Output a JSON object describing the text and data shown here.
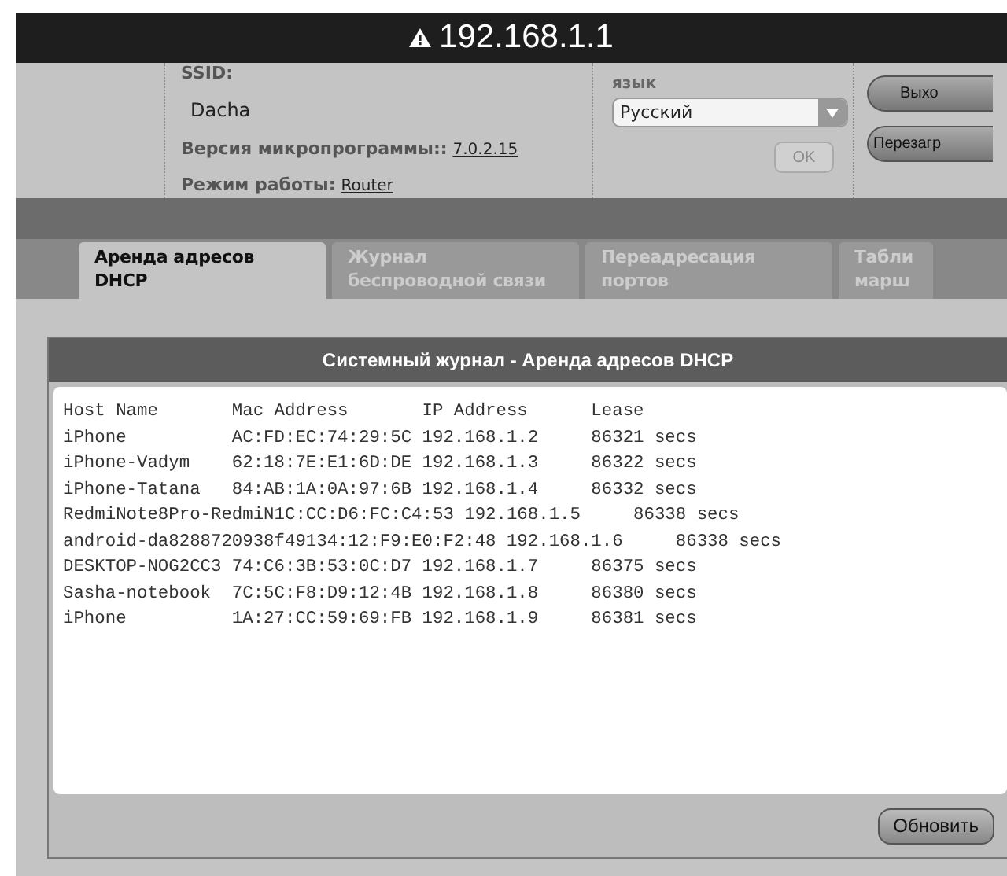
{
  "window": {
    "title": "192.168.1.1"
  },
  "header": {
    "ssid_label": "SSID:",
    "ssid": "Dacha",
    "firmware_label": "Версия микропрограммы::",
    "firmware": "7.0.2.15",
    "mode_label": "Режим работы:",
    "mode": "Router",
    "language_label": "язык",
    "language": "Русский",
    "ok_button": {
      "label": "OK",
      "disabled": true
    },
    "buttons": [
      "Выхо",
      "Перезагр"
    ]
  },
  "tabs": [
    {
      "label": "Аренда адресов DHCP",
      "selected": true
    },
    {
      "label": "Журнал беспроводной связи",
      "selected": false
    },
    {
      "label": "Переадресация портов",
      "selected": false
    },
    {
      "label": "Табли марш",
      "selected": false
    }
  ],
  "panel": {
    "title": "Системный журнал - Аренда адресов DHCP",
    "log_lines": [
      "Host Name       Mac Address       IP Address      Lease",
      "iPhone          AC:FD:EC:74:29:5C 192.168.1.2     86321 secs",
      "iPhone-Vadym    62:18:7E:E1:6D:DE 192.168.1.3     86322 secs",
      "iPhone-Tatana   84:AB:1A:0A:97:6B 192.168.1.4     86332 secs",
      "RedmiNote8Pro-RedmiN1C:CC:D6:FC:C4:53 192.168.1.5     86338 secs",
      "android-da8288720938f49134:12:F9:E0:F2:48 192.168.1.6     86338 secs",
      "DESKTOP-NOG2CC3 74:C6:3B:53:0C:D7 192.168.1.7     86375 secs",
      "Sasha-notebook  7C:5C:F8:D9:12:4B 192.168.1.8     86380 secs",
      "iPhone          1A:27:CC:59:69:FB 192.168.1.9     86381 secs"
    ],
    "refresh_button": "Обновить"
  }
}
